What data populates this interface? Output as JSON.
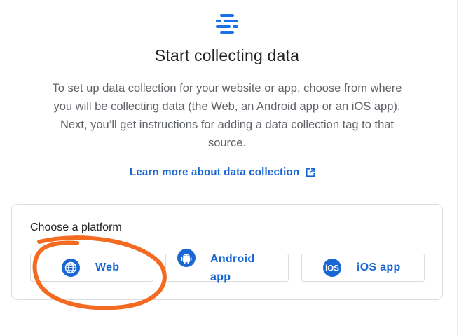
{
  "header": {
    "icon": "data-stream-icon",
    "title": "Start collecting data",
    "description": "To set up data collection for your website or app, choose from where you will be collecting data (the Web, an Android app or an iOS app). Next, you’ll get instructions for adding a data collection tag to that source.",
    "learn_more_label": "Learn more about data collection",
    "learn_more_icon": "open-in-new-icon"
  },
  "platform": {
    "label": "Choose a platform",
    "options": [
      {
        "label": "Web",
        "icon": "globe-icon"
      },
      {
        "label": "Android app",
        "icon": "android-icon"
      },
      {
        "label": "iOS app",
        "icon": "ios-icon"
      }
    ]
  },
  "colors": {
    "accent": "#1967d2",
    "annotation": "#f26b21",
    "border": "#dadce0",
    "text_primary": "#202124",
    "text_secondary": "#5f6368"
  }
}
